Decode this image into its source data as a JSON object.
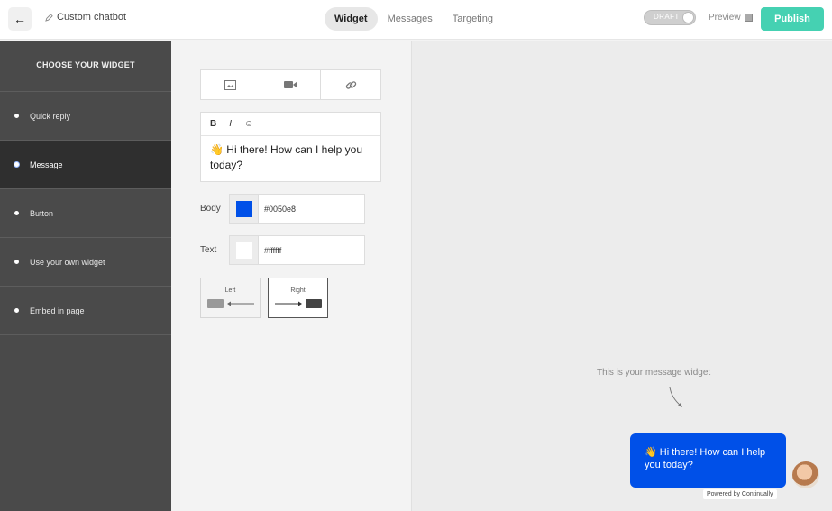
{
  "header": {
    "back_icon": "arrow-left-icon",
    "title": "Custom chatbot",
    "tabs": [
      {
        "label": "Widget",
        "active": true
      },
      {
        "label": "Messages",
        "active": false
      },
      {
        "label": "Targeting",
        "active": false
      }
    ],
    "draft_label": "DRAFT",
    "preview_label": "Preview",
    "publish_label": "Publish",
    "publish_color": "#45d1b2"
  },
  "sidebar": {
    "heading": "CHOOSE YOUR WIDGET",
    "items": [
      {
        "label": "Quick reply",
        "active": false
      },
      {
        "label": "Message",
        "active": true
      },
      {
        "label": "Button",
        "active": false
      },
      {
        "label": "Use your own widget",
        "active": false
      },
      {
        "label": "Embed in page",
        "active": false
      }
    ]
  },
  "editor": {
    "media_icons": [
      "image-icon",
      "video-icon",
      "link-icon"
    ],
    "format_buttons": [
      "B",
      "I",
      "☺"
    ],
    "message_text": "👋 Hi there! How can I help you today?",
    "body_label": "Body",
    "body_color": "#0050e8",
    "text_label": "Text",
    "text_color": "#ffffff",
    "align_left_label": "Left",
    "align_right_label": "Right",
    "align_selected": "Right"
  },
  "preview": {
    "hint": "This is your message widget",
    "bubble_text": "👋 Hi there! How can I help you today?",
    "powered_by": "Powered by Continually"
  }
}
